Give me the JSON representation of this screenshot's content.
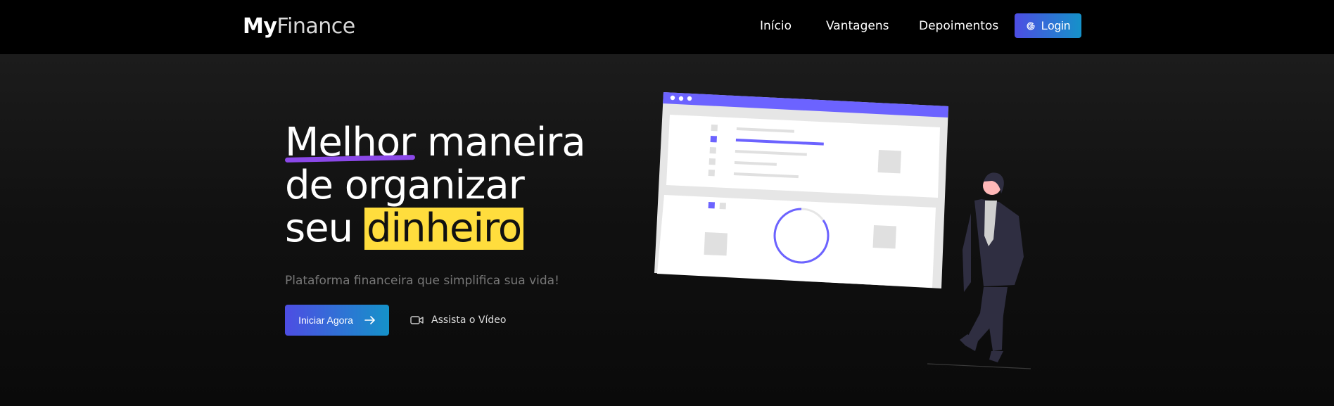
{
  "brand": {
    "logo_bold": "My",
    "logo_light": "Finance"
  },
  "nav": {
    "items": [
      {
        "label": "Início"
      },
      {
        "label": "Vantagens"
      },
      {
        "label": "Depoimentos"
      }
    ],
    "login_label": "Login",
    "login_icon": "google-icon"
  },
  "hero": {
    "headline": {
      "line1_highlight": "Melhor",
      "line1_rest": "maneira",
      "line2": "de organizar",
      "line3_start": "seu",
      "line3_highlight": "dinheiro"
    },
    "subtitle": "Plataforma financeira que simplifica sua vida!",
    "cta_label": "Iniciar Agora",
    "cta_icon": "arrow-right-icon",
    "video_label": "Assista o Vídeo",
    "video_icon": "video-camera-icon"
  },
  "colors": {
    "accent_purple": "#6c63ff",
    "gradient_start": "#4d4de3",
    "gradient_end": "#1592c9",
    "highlight_yellow": "#ffdd3d",
    "underline_purple": "#8b48e8"
  }
}
